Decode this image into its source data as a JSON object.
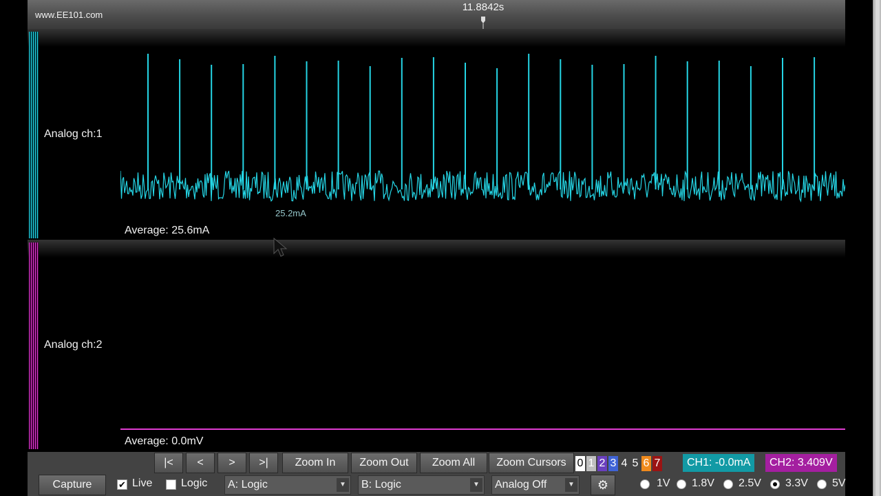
{
  "header": {
    "site": "www.EE101.com",
    "cursor_time": "11.8842s"
  },
  "channels": [
    {
      "label": "Analog ch:1",
      "average": "Average: 25.6mA",
      "color": "#25d6e6",
      "hover_value": "25.2mA"
    },
    {
      "label": "Analog ch:2",
      "average": "Average: 0.0mV",
      "color": "#e03cd2"
    }
  ],
  "toolbar": {
    "nav": [
      "|<",
      "<",
      ">",
      ">|"
    ],
    "zoom_in": "Zoom In",
    "zoom_out": "Zoom Out",
    "zoom_all": "Zoom All",
    "zoom_cursors": "Zoom Cursors",
    "digits": [
      {
        "label": "0",
        "bg": "#ffffff",
        "fg": "#000000"
      },
      {
        "label": "1",
        "bg": "#bfbfbf",
        "fg": "#ffffff"
      },
      {
        "label": "2",
        "bg": "#6a3fbf",
        "fg": "#ffffff"
      },
      {
        "label": "3",
        "bg": "#3f63d6",
        "fg": "#ffffff"
      },
      {
        "label": "4",
        "bg": "#434343",
        "fg": "#ffffff"
      },
      {
        "label": "5",
        "bg": "#434343",
        "fg": "#ffffff"
      },
      {
        "label": "6",
        "bg": "#f08a1c",
        "fg": "#ffffff"
      },
      {
        "label": "7",
        "bg": "#9b1414",
        "fg": "#ffffff"
      }
    ],
    "ch1_readout": "CH1: -0.0mA",
    "ch2_readout": "CH2: 3.409V",
    "ch1_readout_bg": "#129aa5",
    "ch2_readout_bg": "#a41fa0",
    "capture": "Capture",
    "live": {
      "label": "Live",
      "checked": true
    },
    "logic": {
      "label": "Logic",
      "checked": false
    },
    "select_a": "A: Logic",
    "select_b": "B: Logic",
    "select_analog": "Analog Off",
    "settings_icon": "gear-icon",
    "voltages": [
      {
        "label": "1V",
        "selected": false
      },
      {
        "label": "1.8V",
        "selected": false
      },
      {
        "label": "2.5V",
        "selected": false
      },
      {
        "label": "3.3V",
        "selected": true
      },
      {
        "label": "5V",
        "selected": false
      }
    ]
  }
}
